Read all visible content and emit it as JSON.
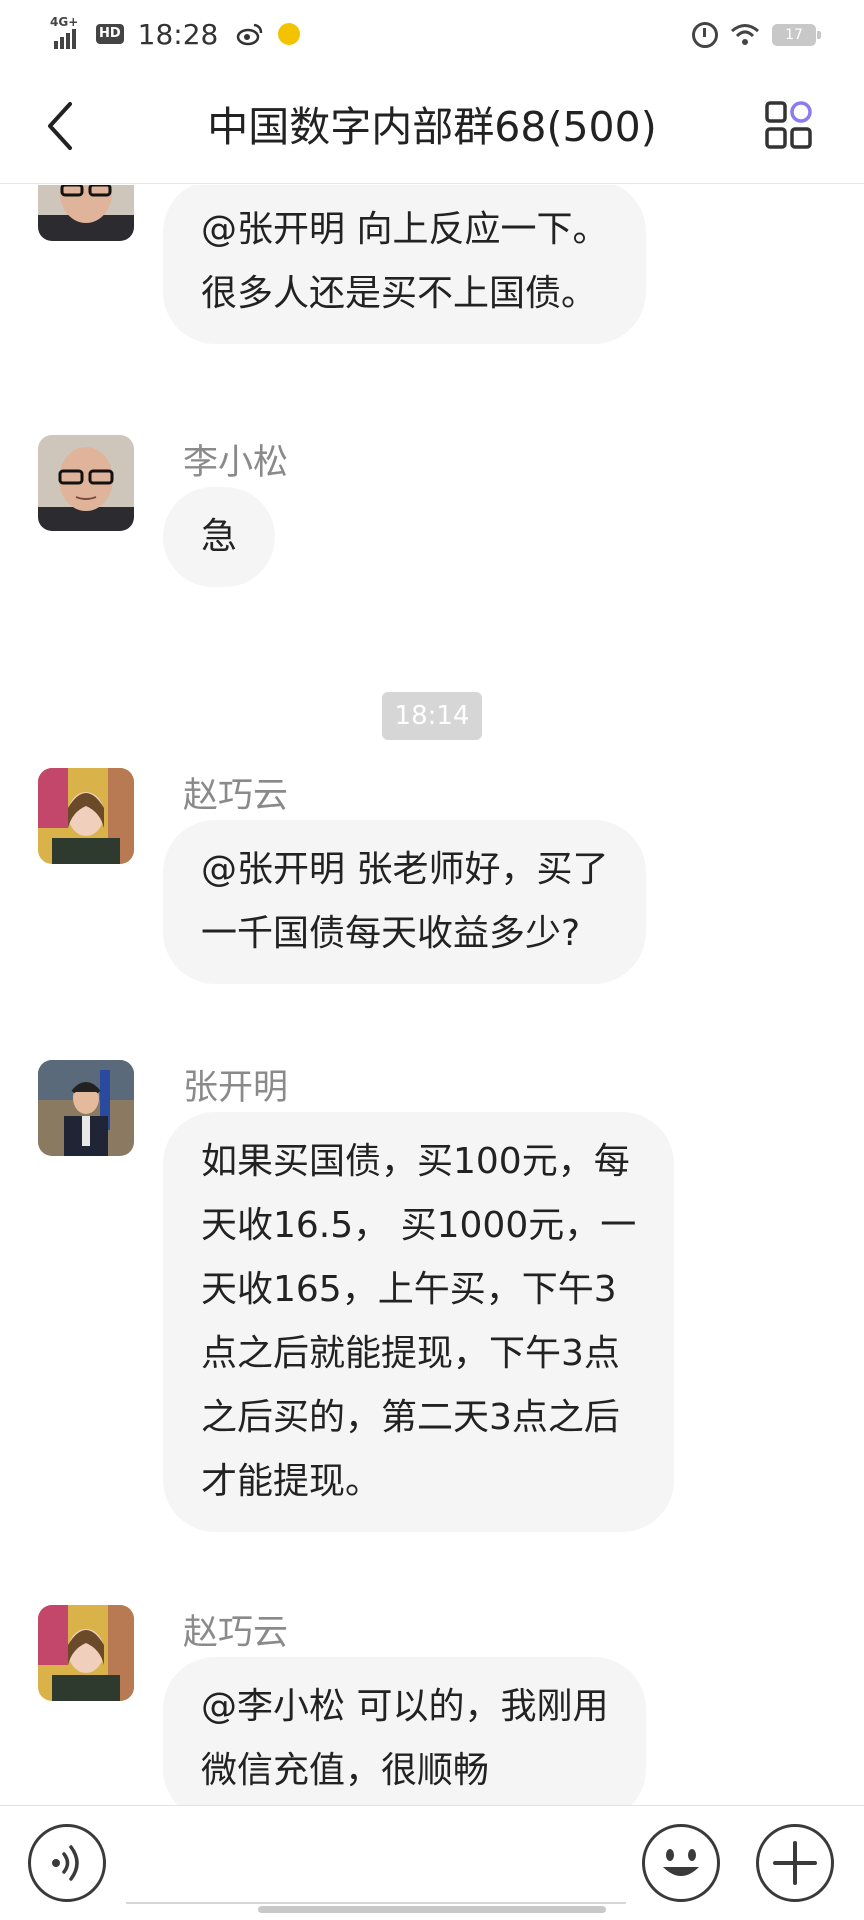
{
  "status_bar": {
    "network": "4G+",
    "hd": "HD",
    "time": "18:28",
    "battery": "17"
  },
  "header": {
    "title": "中国数字内部群68(500)"
  },
  "messages": [
    {
      "sender": "",
      "lines": [
        "@张开明 向上反应一下。",
        "很多人还是买不上国债。"
      ]
    },
    {
      "sender": "李小松",
      "lines": [
        "急"
      ]
    },
    {
      "sender": "赵巧云",
      "lines": [
        "@张开明 张老师好，买了",
        "一千国债每天收益多少?"
      ]
    },
    {
      "sender": "张开明",
      "lines": [
        "如果买国债，买100元，每",
        "天收16.5， 买1000元，一",
        "天收165，上午买，下午3",
        "点之后就能提现，下午3点",
        "之后买的，第二天3点之后",
        "才能提现。"
      ]
    },
    {
      "sender": "赵巧云",
      "lines": [
        "@李小松 可以的，我刚用",
        "微信充值，很顺畅"
      ]
    }
  ],
  "timestamp": "18:14",
  "input": {
    "value": "",
    "placeholder": ""
  },
  "icons": {
    "back": "back-arrow-icon",
    "menu": "group-menu-icon",
    "voice": "voice-icon",
    "emoji": "emoji-icon",
    "plus": "plus-icon"
  },
  "colors": {
    "bubble": "#f5f5f5",
    "timestamp_bg": "#d6d6d6",
    "menu_accent": "#8a7cf0"
  }
}
